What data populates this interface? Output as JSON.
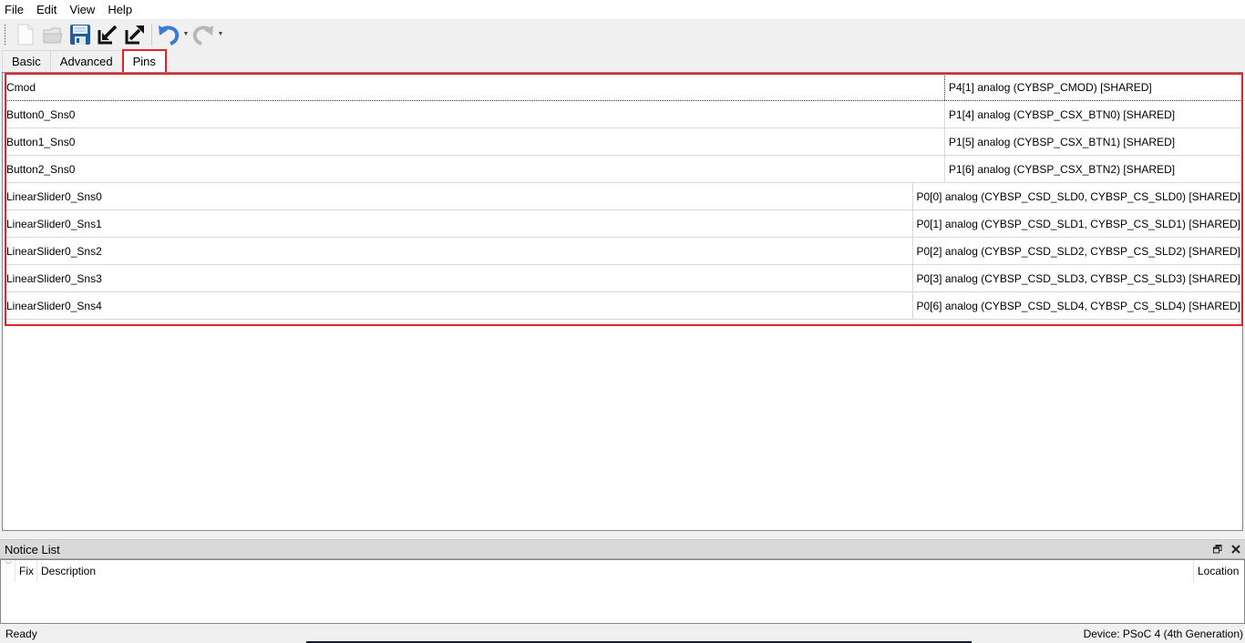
{
  "menu": {
    "items": [
      "File",
      "Edit",
      "View",
      "Help"
    ]
  },
  "toolbar": {
    "buttons": [
      {
        "name": "new-file",
        "icon": "new-document-icon",
        "enabled": false
      },
      {
        "name": "open-file",
        "icon": "open-folder-icon",
        "enabled": false
      },
      {
        "name": "save",
        "icon": "save-icon",
        "enabled": true
      },
      {
        "name": "import",
        "icon": "import-icon",
        "enabled": true
      },
      {
        "name": "export",
        "icon": "export-icon",
        "enabled": true
      },
      {
        "name": "undo",
        "icon": "undo-icon",
        "enabled": true
      },
      {
        "name": "redo",
        "icon": "redo-icon",
        "enabled": false
      }
    ]
  },
  "tabs": [
    {
      "label": "Basic",
      "active": false
    },
    {
      "label": "Advanced",
      "active": false
    },
    {
      "label": "Pins",
      "active": true
    }
  ],
  "pins": {
    "rows": [
      {
        "name": "Cmod",
        "pin": "P4[1] analog (CYBSP_CMOD) [SHARED]"
      },
      {
        "name": "Button0_Sns0",
        "pin": "P1[4] analog (CYBSP_CSX_BTN0) [SHARED]"
      },
      {
        "name": "Button1_Sns0",
        "pin": "P1[5] analog (CYBSP_CSX_BTN1) [SHARED]"
      },
      {
        "name": "Button2_Sns0",
        "pin": "P1[6] analog (CYBSP_CSX_BTN2) [SHARED]"
      },
      {
        "name": "LinearSlider0_Sns0",
        "pin": "P0[0] analog (CYBSP_CSD_SLD0, CYBSP_CS_SLD0) [SHARED]"
      },
      {
        "name": "LinearSlider0_Sns1",
        "pin": "P0[1] analog (CYBSP_CSD_SLD1, CYBSP_CS_SLD1) [SHARED]"
      },
      {
        "name": "LinearSlider0_Sns2",
        "pin": "P0[2] analog (CYBSP_CSD_SLD2, CYBSP_CS_SLD2) [SHARED]"
      },
      {
        "name": "LinearSlider0_Sns3",
        "pin": "P0[3] analog (CYBSP_CSD_SLD3, CYBSP_CS_SLD3) [SHARED]"
      },
      {
        "name": "LinearSlider0_Sns4",
        "pin": "P0[6] analog (CYBSP_CSD_SLD4, CYBSP_CS_SLD4) [SHARED]"
      }
    ]
  },
  "notice_list": {
    "title": "Notice List",
    "columns": {
      "fix": "Fix",
      "description": "Description",
      "location": "Location"
    },
    "float_icon": "float-window-icon",
    "close_icon": "close-icon"
  },
  "status": {
    "left": "Ready",
    "right": "Device: PSoC 4 (4th Generation)"
  },
  "colors": {
    "highlight": "#e8202a",
    "save_blue": "#1f5f9e",
    "undo_blue": "#3a7bd5"
  }
}
